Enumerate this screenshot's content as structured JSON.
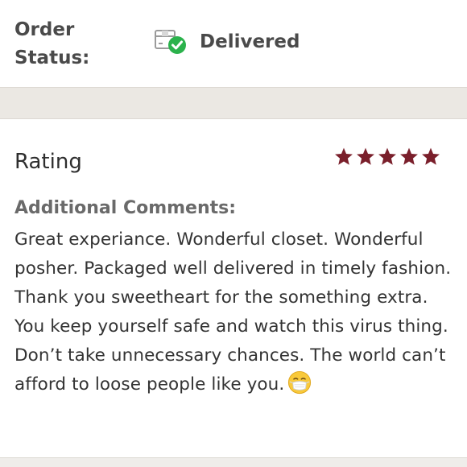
{
  "order_status": {
    "label": "Order Status:",
    "value": "Delivered",
    "icon": "package-delivered-icon"
  },
  "rating": {
    "title": "Rating",
    "stars": 5,
    "max_stars": 5,
    "star_color": "#7a1f2b"
  },
  "comments": {
    "label": "Additional Comments:",
    "text": "Great experiance. Wonderful closet. Wonderful posher. Packaged well delivered in timely fashion. Thank you sweetheart for the something extra. You keep yourself safe and watch this virus thing. Don’t take unnecessary chances. The world can’t afford to loose people like you.",
    "emoji": "face-with-medical-mask-icon"
  }
}
